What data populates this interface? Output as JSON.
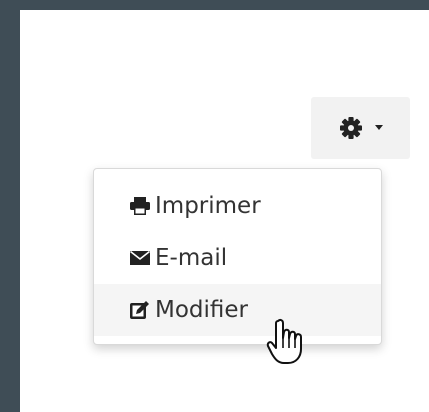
{
  "toolbar": {
    "actions_button": {
      "icon": "gear-icon",
      "caret": "caret-down-icon"
    }
  },
  "menu": {
    "items": [
      {
        "label": "Imprimer",
        "icon": "print-icon"
      },
      {
        "label": "E-mail",
        "icon": "envelope-icon"
      },
      {
        "label": "Modifier",
        "icon": "edit-icon"
      }
    ],
    "hovered_index": 2
  },
  "colors": {
    "background": "#3f4d56",
    "panel": "#ffffff",
    "text": "#333333",
    "hover": "#f5f5f5"
  }
}
